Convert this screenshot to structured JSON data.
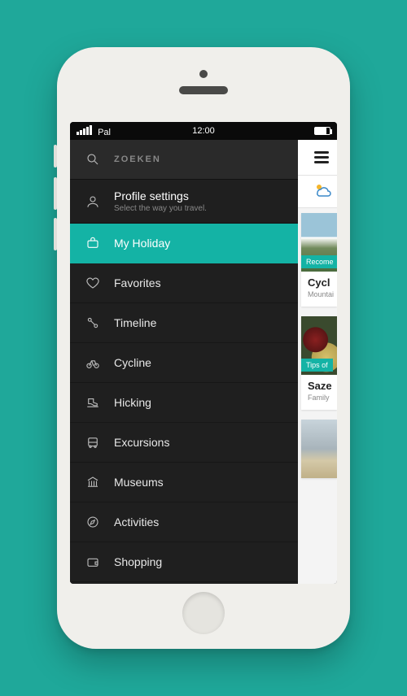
{
  "status": {
    "carrier": "Pal",
    "time": "12:00"
  },
  "search": {
    "label": "ZOEKEN"
  },
  "profile": {
    "title": "Profile settings",
    "subtitle": "Select the way you travel."
  },
  "menu": {
    "items": [
      {
        "key": "holiday",
        "label": "My Holiday",
        "active": true
      },
      {
        "key": "favorites",
        "label": "Favorites",
        "active": false
      },
      {
        "key": "timeline",
        "label": "Timeline",
        "active": false
      },
      {
        "key": "cycline",
        "label": "Cycline",
        "active": false
      },
      {
        "key": "hicking",
        "label": "Hicking",
        "active": false
      },
      {
        "key": "excursions",
        "label": "Excursions",
        "active": false
      },
      {
        "key": "museums",
        "label": "Museums",
        "active": false
      },
      {
        "key": "activities",
        "label": "Activities",
        "active": false
      },
      {
        "key": "shopping",
        "label": "Shopping",
        "active": false
      }
    ]
  },
  "peek": {
    "cards": [
      {
        "tag": "Recome",
        "title": "Cycl",
        "subtitle": "Mountai"
      },
      {
        "tag": "Tips of",
        "title": "Saze",
        "subtitle": "Family"
      }
    ]
  },
  "colors": {
    "accent": "#14b3a5",
    "drawer": "#1f1f1f",
    "page_bg": "#1fa89a"
  }
}
